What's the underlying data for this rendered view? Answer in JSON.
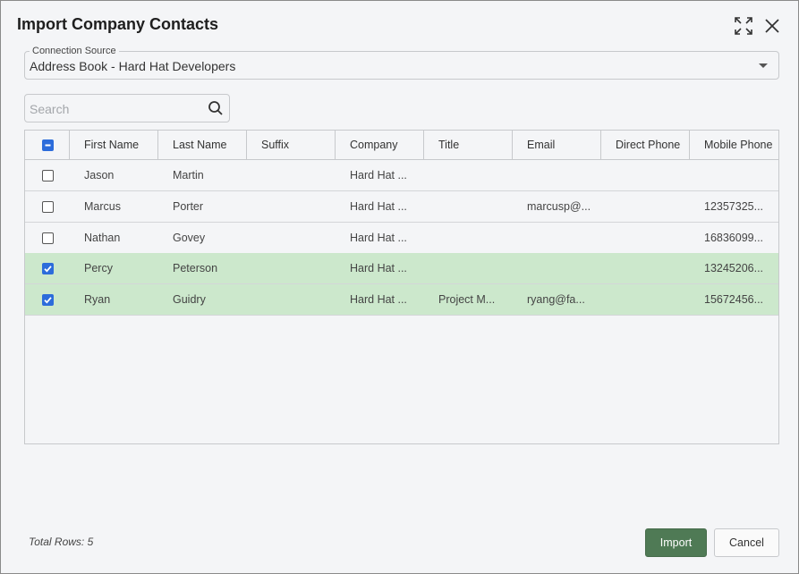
{
  "dialog": {
    "title": "Import Company Contacts"
  },
  "connection": {
    "legend": "Connection Source",
    "value": "Address Book - Hard Hat Developers"
  },
  "search": {
    "placeholder": "Search"
  },
  "grid": {
    "columns": [
      "First Name",
      "Last Name",
      "Suffix",
      "Company",
      "Title",
      "Email",
      "Direct Phone",
      "Mobile Phone"
    ],
    "rows": [
      {
        "first": "Jason",
        "last": "Martin",
        "suffix": "",
        "company": "Hard Hat ...",
        "title": "",
        "email": "",
        "direct": "",
        "mobile": "",
        "checked": false
      },
      {
        "first": "Marcus",
        "last": "Porter",
        "suffix": "",
        "company": "Hard Hat ...",
        "title": "",
        "email": "marcusp@...",
        "direct": "",
        "mobile": "12357325...",
        "checked": false
      },
      {
        "first": "Nathan",
        "last": "Govey",
        "suffix": "",
        "company": "Hard Hat ...",
        "title": "",
        "email": "",
        "direct": "",
        "mobile": "16836099...",
        "checked": false
      },
      {
        "first": "Percy",
        "last": "Peterson",
        "suffix": "",
        "company": "Hard Hat ...",
        "title": "",
        "email": "",
        "direct": "",
        "mobile": "13245206...",
        "checked": true
      },
      {
        "first": "Ryan",
        "last": "Guidry",
        "suffix": "",
        "company": "Hard Hat ...",
        "title": "Project M...",
        "email": "ryang@fa...",
        "direct": "",
        "mobile": "15672456...",
        "checked": true
      }
    ]
  },
  "footer": {
    "total_rows": "Total Rows: 5",
    "import_label": "Import",
    "cancel_label": "Cancel"
  },
  "colors": {
    "selected_row": "#cce8cc",
    "checkbox_accent": "#2c6cdb",
    "import_button": "#4f7a55"
  }
}
